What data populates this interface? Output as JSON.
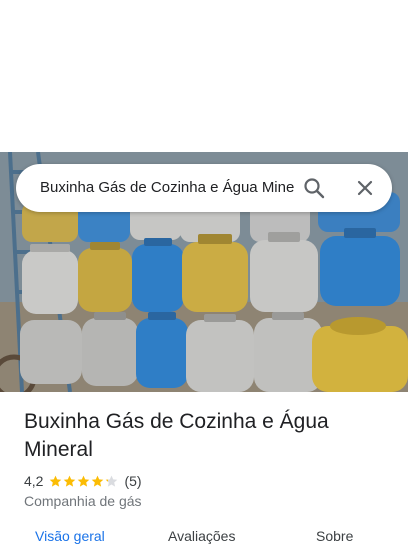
{
  "search": {
    "query": "Buxinha Gás de Cozinha e Água Mineral",
    "search_icon": "search-icon",
    "close_icon": "close-icon"
  },
  "place": {
    "title": "Buxinha Gás de Cozinha e Água Mineral",
    "rating": "4,2",
    "rating_value": 4.2,
    "stars_max": 5,
    "review_count": "(5)",
    "category": "Companhia de gás"
  },
  "tabs": [
    {
      "label": "Visão geral",
      "active": true
    },
    {
      "label": "Avaliações",
      "active": false
    },
    {
      "label": "Sobre",
      "active": false
    }
  ],
  "colors": {
    "accent": "#1a73e8",
    "star": "#fbbc04",
    "star_empty": "#dadce0"
  }
}
